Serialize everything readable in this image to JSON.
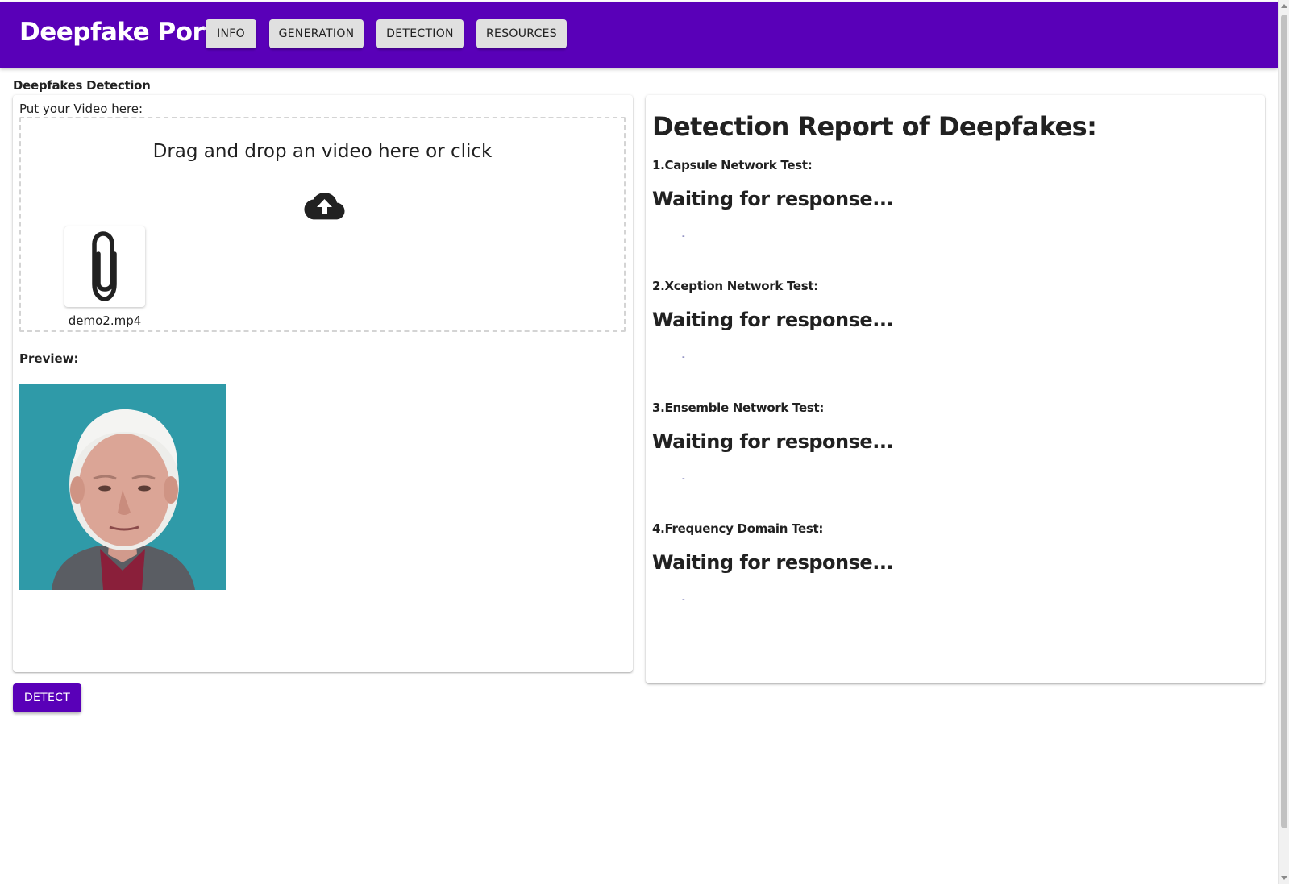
{
  "app": {
    "title": "Deepfake Portal",
    "accent_color": "#5900b8"
  },
  "nav": {
    "items": [
      {
        "label": "INFO"
      },
      {
        "label": "GENERATION"
      },
      {
        "label": "DETECTION"
      },
      {
        "label": "RESOURCES"
      }
    ]
  },
  "detection": {
    "section_title": "Deepfakes Detection",
    "upload_label": "Put your Video here:",
    "dropzone_text": "Drag and drop an video here or click",
    "upload_icon": "cloud-upload-icon",
    "file": {
      "name": "demo2.mp4",
      "icon": "paperclip-icon"
    },
    "preview_label": "Preview:",
    "detect_button": "DETECT"
  },
  "report": {
    "title": "Detection Report of Deepfakes:",
    "tests": [
      {
        "name": "1.Capsule Network Test:",
        "status": "Waiting for response...",
        "result": "-"
      },
      {
        "name": "2.Xception Network Test:",
        "status": "Waiting for response...",
        "result": "-"
      },
      {
        "name": "3.Ensemble Network Test:",
        "status": "Waiting for response...",
        "result": "-"
      },
      {
        "name": "4.Frequency Domain Test:",
        "status": "Waiting for response...",
        "result": "-"
      }
    ]
  }
}
